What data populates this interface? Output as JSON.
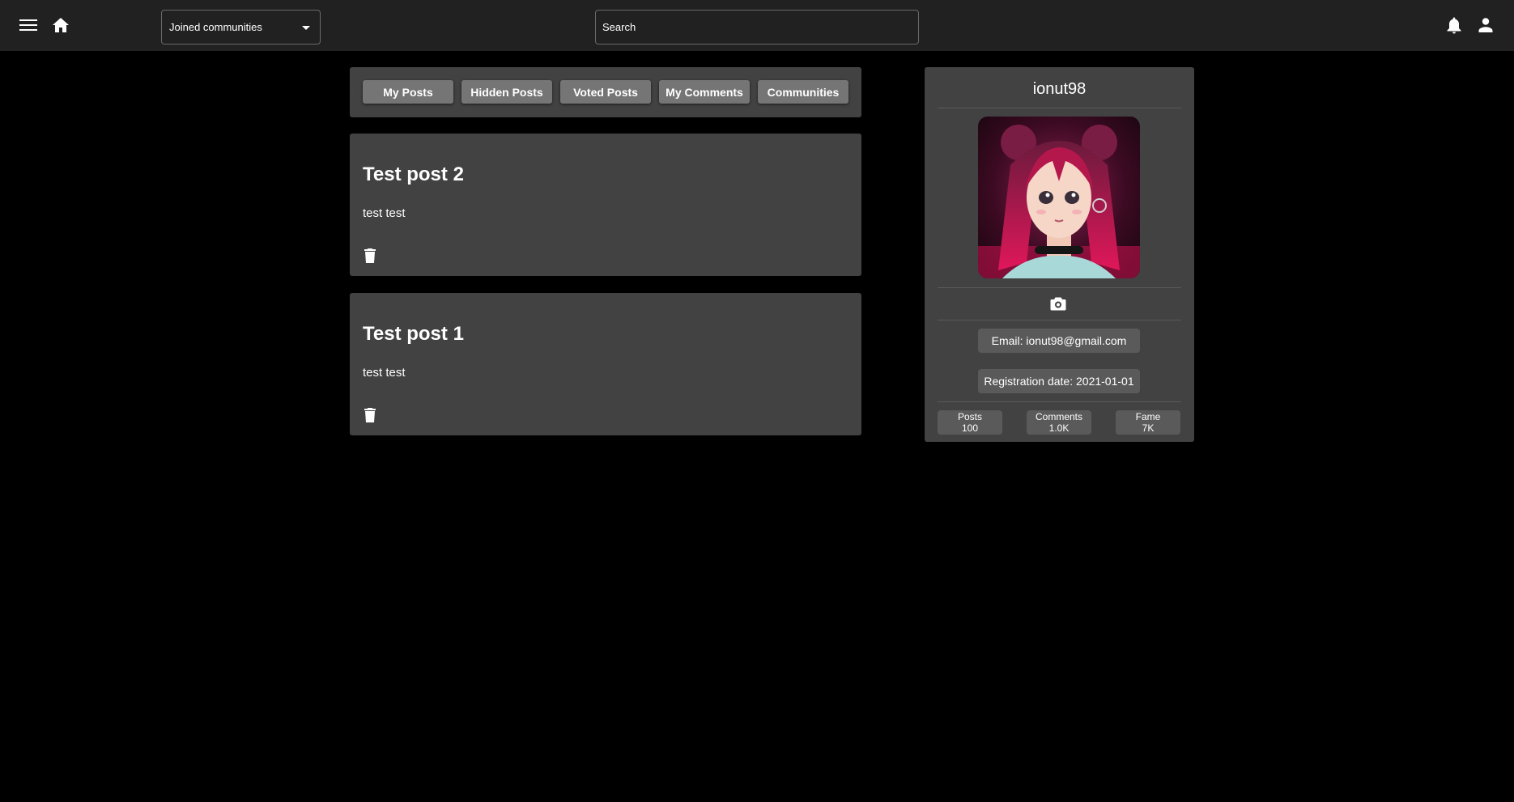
{
  "header": {
    "menu_icon": "menu-icon",
    "home_icon": "home-icon",
    "community_select": {
      "selected": "Joined communities"
    },
    "search": {
      "placeholder": "Search"
    },
    "notifications_icon": "bell-icon",
    "account_icon": "person-icon"
  },
  "tabs": [
    {
      "label": "My Posts"
    },
    {
      "label": "Hidden Posts"
    },
    {
      "label": "Voted Posts"
    },
    {
      "label": "My Comments"
    },
    {
      "label": "Communities"
    }
  ],
  "posts": [
    {
      "title": "Test post 2",
      "body": "test test"
    },
    {
      "title": "Test post 1",
      "body": "test test"
    }
  ],
  "profile": {
    "username": "ionut98",
    "email_label": "Email: ionut98@gmail.com",
    "registration_label": "Registration date: 2021-01-01",
    "stats": [
      {
        "label": "Posts",
        "value": "100"
      },
      {
        "label": "Comments",
        "value": "1.0K"
      },
      {
        "label": "Fame",
        "value": "7K"
      }
    ]
  },
  "colors": {
    "background": "#000000",
    "topbar": "#212121",
    "panel": "#424242",
    "tab_button": "#757575",
    "pill": "#5a5a5a"
  }
}
